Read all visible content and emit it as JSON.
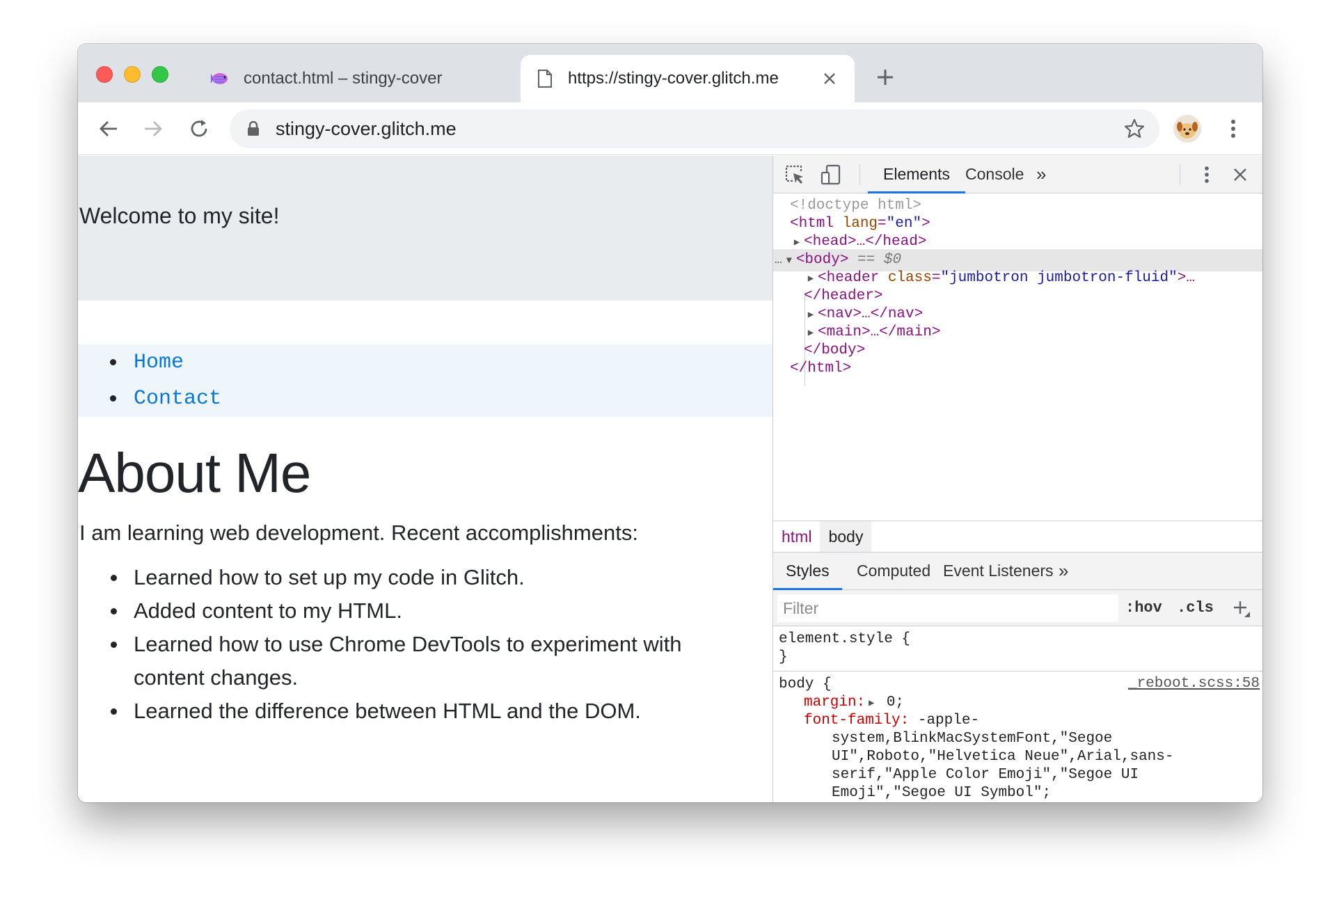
{
  "browser": {
    "tabs": [
      {
        "title": "contact.html – stingy-cover",
        "active": false,
        "favicon": "glitch-fish-icon"
      },
      {
        "title": "https://stingy-cover.glitch.me",
        "active": true,
        "favicon": "document-icon"
      }
    ],
    "address": "stingy-cover.glitch.me"
  },
  "page": {
    "jumbotron_text": "Welcome to my site!",
    "nav": [
      "Home",
      "Contact"
    ],
    "heading": "About Me",
    "intro": "I am learning web development. Recent accomplishments:",
    "accomplishments": [
      "Learned how to set up my code in Glitch.",
      "Added content to my HTML.",
      "Learned how to use Chrome DevTools to experiment with content changes.",
      "Learned the difference between HTML and the DOM."
    ]
  },
  "devtools": {
    "tabs": {
      "elements": "Elements",
      "console": "Console",
      "more": "»"
    },
    "dom": {
      "doctype": "<!doctype html>",
      "html_open": "<html",
      "lang_attr": "lang",
      "lang_val": "\"en\"",
      "head": "<head>…</head>",
      "body_open": "<body>",
      "eq": "==",
      "dollar0": "$0",
      "header_open": "<header",
      "class_attr": "class",
      "class_val": "\"jumbotron jumbotron-fluid\"",
      "header_rest": ">…",
      "header_close": "</header>",
      "nav": "<nav>…</nav>",
      "main": "<main>…</main>",
      "body_close": "</body>",
      "html_close": "</html>"
    },
    "breadcrumbs": [
      "html",
      "body"
    ],
    "subtabs": {
      "styles": "Styles",
      "computed": "Computed",
      "listeners": "Event Listeners",
      "more": "»"
    },
    "filter_placeholder": "Filter",
    "hov": ":hov",
    "cls": ".cls",
    "rules": {
      "element_selector": "element.style {",
      "element_close": "}",
      "body_selector": "body {",
      "body_source": "_reboot.scss:58",
      "margin_prop": "margin:",
      "margin_val": " 0;",
      "ff_prop": "font-family:",
      "ff_line1": " -apple-",
      "ff_line2": "system,BlinkMacSystemFont,\"Segoe",
      "ff_line3": "UI\",Roboto,\"Helvetica Neue\",Arial,sans-",
      "ff_line4": "serif,\"Apple Color Emoji\",\"Segoe UI",
      "ff_line5": "Emoji\",\"Segoe UI Symbol\";"
    }
  },
  "colors": {
    "link": "#0b76d4",
    "tag": "#881280",
    "attr": "#994500",
    "value": "#1a1aa6",
    "property": "#c80000",
    "accent": "#1a73e8"
  }
}
